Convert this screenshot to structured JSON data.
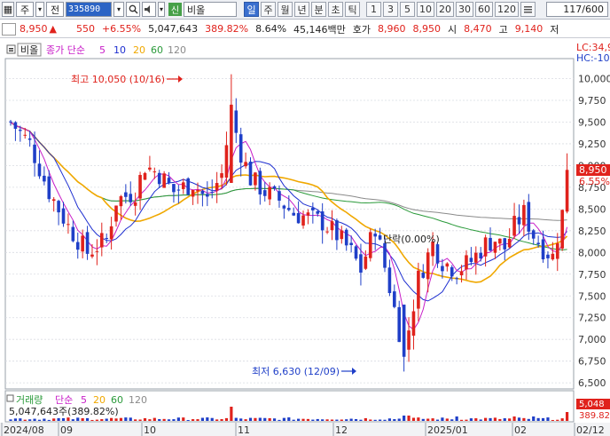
{
  "toolbar": {
    "type_label": "주",
    "market_label": "전",
    "code": "335890",
    "name": "비올",
    "sin_label": "신",
    "period_tabs": [
      "일",
      "주",
      "월",
      "년",
      "분",
      "초",
      "틱"
    ],
    "active_tab": "일",
    "intervals": [
      "1",
      "3",
      "5",
      "10",
      "20",
      "30",
      "60",
      "120"
    ],
    "count": "117/600"
  },
  "quote": {
    "price": "8,950",
    "change": "550",
    "change_pct": "+6.55%",
    "volume": "5,047,643",
    "volume_ratio": "389.82%",
    "turnover_ratio": "8.64%",
    "amount": "45,146백만",
    "bid_label": "호가",
    "bid1": "8,960",
    "bid2": "8,950",
    "open_label": "시",
    "open": "8,470",
    "high_label": "고",
    "high": "9,140",
    "low_label": "저"
  },
  "chart_data": {
    "type": "candlestick",
    "legend": {
      "price_label": "비올",
      "ma_label": "종가 단순",
      "ma_periods": [
        "5",
        "10",
        "20",
        "60",
        "120"
      ]
    },
    "y_ticks": [
      10000,
      9750,
      9500,
      9250,
      9000,
      8750,
      8500,
      8250,
      8000,
      7750,
      7500,
      7250,
      7000,
      6750,
      6500
    ],
    "y_tick_labels": [
      "10,000",
      "9,750",
      "9,500",
      "9,250",
      "9,000",
      "8,750",
      "8,500",
      "8,250",
      "8,000",
      "7,750",
      "7,500",
      "7,250",
      "7,000",
      "6,750",
      "6,500"
    ],
    "ylim": [
      6430,
      10230
    ],
    "lc_label": "LC:34,9",
    "hc_label": "HC:-10",
    "last_price_label": "8,950",
    "last_pct_label": "6.55%",
    "max_annotation": "최고 10,050 (10/16)",
    "min_annotation": "최저 6,630 (12/09)",
    "extra_annotation": "단락(0.00%)",
    "x_labels": [
      "2024/08",
      "09",
      "10",
      "11",
      "12",
      "2025/01",
      "02",
      "02/12"
    ],
    "volume_legend": {
      "label": "거래량",
      "ma_label": "단순",
      "periods": [
        "5",
        "20",
        "60",
        "120"
      ],
      "value_text": "5,047,643주(389.82%)",
      "axis_label_1": "5,048",
      "axis_label_2": "389.82"
    },
    "colors": {
      "up": "#e0221c",
      "down": "#1f3fc8",
      "ma5": "#222222",
      "ma10": "#1e2fd0",
      "ma20": "#f0a800",
      "ma60": "#2a9a3a",
      "ma120": "#8a8a8a",
      "ma_magenta": "#c81ec8"
    }
  }
}
